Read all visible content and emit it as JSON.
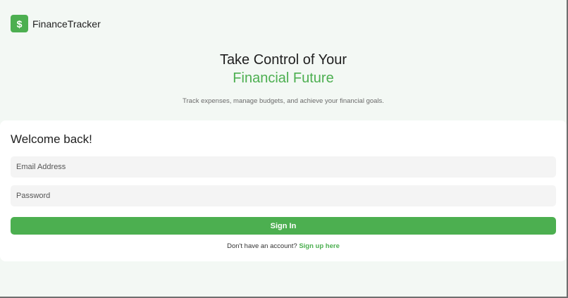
{
  "header": {
    "logo_symbol": "$",
    "brand": "FinanceTracker"
  },
  "hero": {
    "title_line1": "Take Control of Your",
    "title_line2": "Financial Future",
    "subtitle": "Track expenses, manage budgets, and achieve your financial goals."
  },
  "login": {
    "heading": "Welcome back!",
    "email_placeholder": "Email Address",
    "password_placeholder": "Password",
    "signin_label": "Sign In",
    "signup_prompt": "Don't have an account?",
    "signup_link": "Sign up here"
  },
  "colors": {
    "accent": "#4caf50",
    "background": "#f3f8f4",
    "card": "#ffffff",
    "field": "#f4f4f4"
  },
  "icons": {
    "logo": "dollar-sign-icon"
  }
}
